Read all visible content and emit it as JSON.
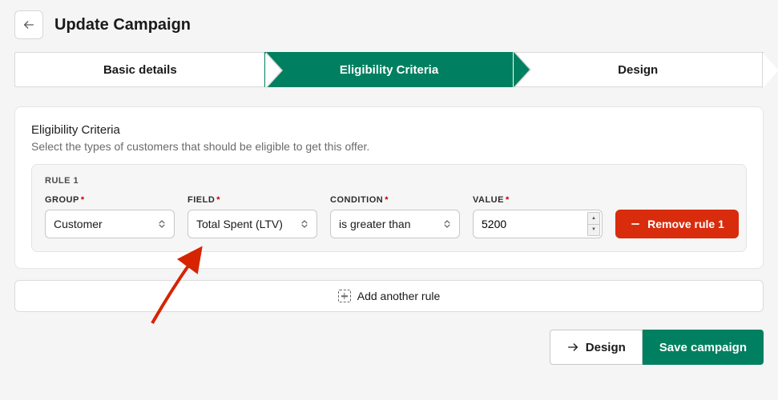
{
  "header": {
    "title": "Update Campaign"
  },
  "stepper": {
    "steps": [
      {
        "label": "Basic details",
        "active": false
      },
      {
        "label": "Eligibility Criteria",
        "active": true
      },
      {
        "label": "Design",
        "active": false
      }
    ]
  },
  "panel": {
    "title": "Eligibility Criteria",
    "subtitle": "Select the types of customers that should be eligible to get this offer."
  },
  "rule": {
    "heading": "RULE 1",
    "group_label": "GROUP",
    "field_label": "FIELD",
    "condition_label": "CONDITION",
    "value_label": "VALUE",
    "required_mark": "*",
    "group_value": "Customer",
    "field_value": "Total Spent (LTV)",
    "condition_value": "is greater than",
    "value_value": "5200",
    "remove_label": "Remove rule 1"
  },
  "add_rule_label": "Add another rule",
  "footer": {
    "design_label": "Design",
    "save_label": "Save campaign"
  },
  "colors": {
    "accent": "#008060",
    "danger": "#d82c0d"
  }
}
